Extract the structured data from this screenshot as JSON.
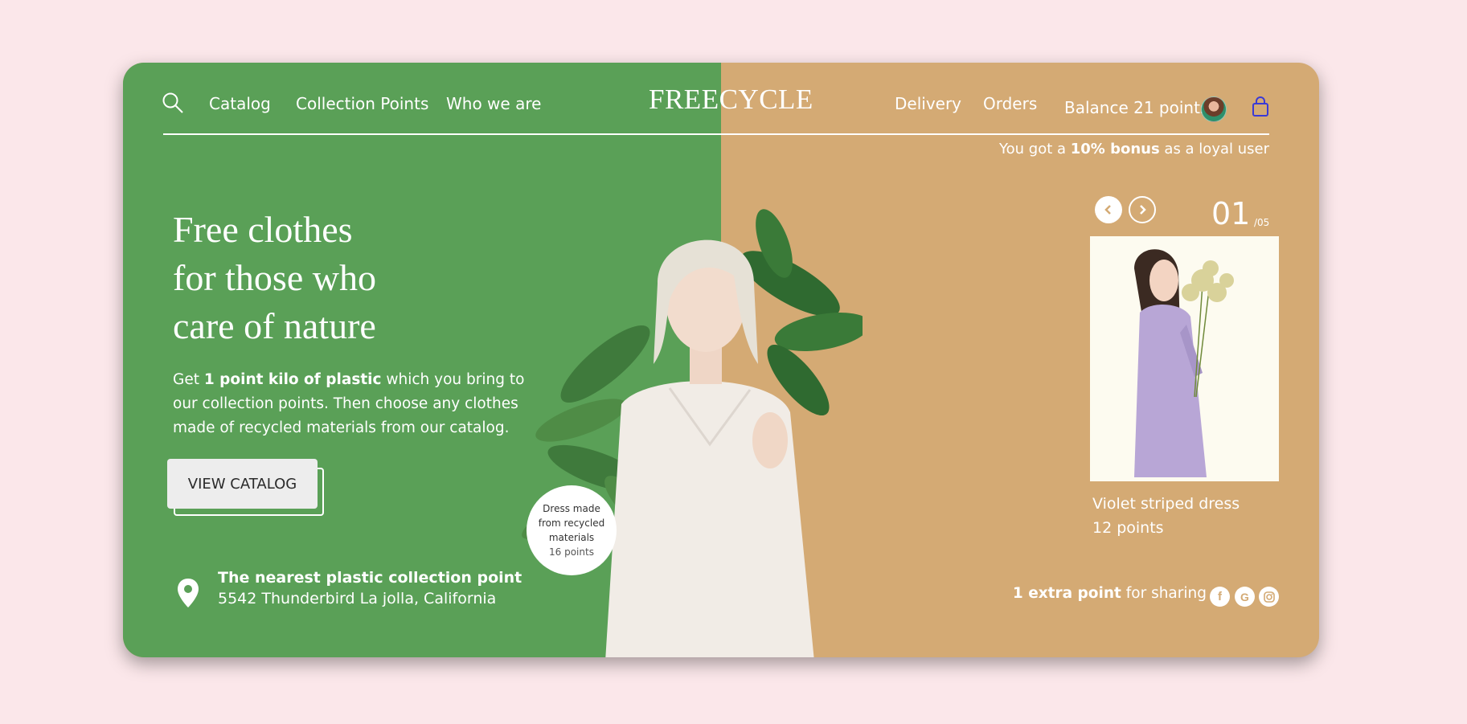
{
  "nav": {
    "links": [
      "Catalog",
      "Collection Points",
      "Who we are"
    ],
    "logo": "FREECYCLE",
    "right_links": [
      "Delivery",
      "Orders"
    ],
    "balance": "Balance 21 points"
  },
  "bonus": {
    "prefix": "You got a ",
    "highlight": "10% bonus",
    "suffix": " as a loyal user"
  },
  "hero": {
    "headline": [
      "Free clothes",
      "for those who",
      "care of nature"
    ],
    "desc_prefix": "Get ",
    "desc_bold": "1 point kilo of plastic",
    "desc_suffix": " which you bring to our collection points. Then choose any clothes made of recycled materials from our catalog.",
    "cta": "VIEW CATALOG"
  },
  "badge": {
    "lines": [
      "Dress made",
      "from recycled",
      "materials"
    ],
    "points": "16 points"
  },
  "location": {
    "title": "The nearest plastic collection point",
    "address": "5542 Thunderbird La jolla, California"
  },
  "product": {
    "current": "01",
    "total": "/05",
    "name": "Violet striped dress",
    "points": "12 points"
  },
  "share": {
    "bold": "1 extra point",
    "text": " for sharing"
  },
  "icons": [
    "search-icon",
    "avatar",
    "shopping-bag-icon",
    "chevron-left-icon",
    "chevron-right-icon",
    "location-pin-icon",
    "facebook-icon",
    "google-icon",
    "instagram-icon"
  ],
  "colors": {
    "green": "#5aa057",
    "tan": "#d4aa74",
    "page_bg": "#fbe7ea",
    "bag_icon": "#3a3ad6"
  }
}
